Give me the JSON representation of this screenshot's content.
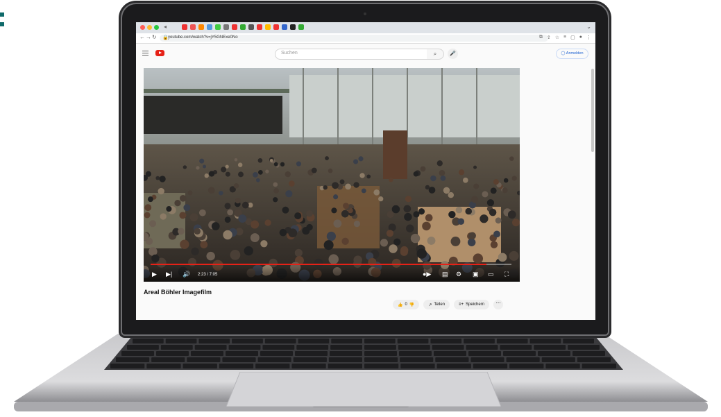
{
  "browser": {
    "url": "youtube.com/watch?v=jY5GNExe0No",
    "traffic_colors": [
      "#ff5f57",
      "#febc2e",
      "#28c840"
    ],
    "tab_icon_colors": [
      "#e33",
      "#e55",
      "#f80",
      "#59d",
      "#4c4",
      "#777",
      "#e33",
      "#3a3",
      "#555",
      "#e33",
      "#fb0",
      "#e33",
      "#36c",
      "#222",
      "#3a3"
    ]
  },
  "youtube": {
    "search_placeholder": "Suchen",
    "signin_label": "Anmelden",
    "video": {
      "time": "2:23 / 7:05",
      "progress": 0.93
    },
    "title": "Areal Böhler Imagefilm",
    "actions": {
      "like_count": "0",
      "share_label": "Teilen",
      "save_label": "Speichern"
    }
  }
}
